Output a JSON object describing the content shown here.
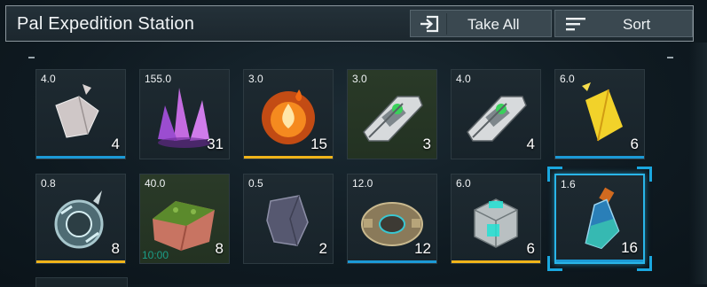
{
  "header": {
    "title": "Pal Expedition Station",
    "take_all_label": "Take All",
    "sort_label": "Sort"
  },
  "colors": {
    "accent_blue": "#1c9ad6",
    "accent_yellow": "#f0b41a",
    "selected_border": "#29b5e8",
    "timer_text": "#1b9e88"
  },
  "slots": [
    {
      "weight": "4.0",
      "quantity": "4",
      "icon": "paldium-fragment-icon",
      "bar": "blue"
    },
    {
      "weight": "155.0",
      "quantity": "31",
      "icon": "pure-quartz-icon",
      "bar": "none"
    },
    {
      "weight": "3.0",
      "quantity": "15",
      "icon": "flame-organ-icon",
      "bar": "yellow"
    },
    {
      "weight": "3.0",
      "quantity": "3",
      "icon": "mechanical-part-icon",
      "bar": "none",
      "tint": "green"
    },
    {
      "weight": "4.0",
      "quantity": "4",
      "icon": "mechanical-part-icon",
      "bar": "none"
    },
    {
      "weight": "6.0",
      "quantity": "6",
      "icon": "yellow-crystal-icon",
      "bar": "blue"
    },
    {
      "weight": "0.8",
      "quantity": "8",
      "icon": "ice-orb-icon",
      "bar": "yellow"
    },
    {
      "weight": "40.0",
      "quantity": "8",
      "icon": "meat-block-icon",
      "bar": "none",
      "tint": "green",
      "timer": "10:00"
    },
    {
      "weight": "0.5",
      "quantity": "2",
      "icon": "stone-chunk-icon",
      "bar": "none"
    },
    {
      "weight": "12.0",
      "quantity": "12",
      "icon": "ancient-gear-icon",
      "bar": "blue"
    },
    {
      "weight": "6.0",
      "quantity": "6",
      "icon": "ancient-cube-icon",
      "bar": "yellow"
    },
    {
      "weight": "1.6",
      "quantity": "16",
      "icon": "potion-bottle-icon",
      "bar": "blue",
      "selected": true
    }
  ]
}
